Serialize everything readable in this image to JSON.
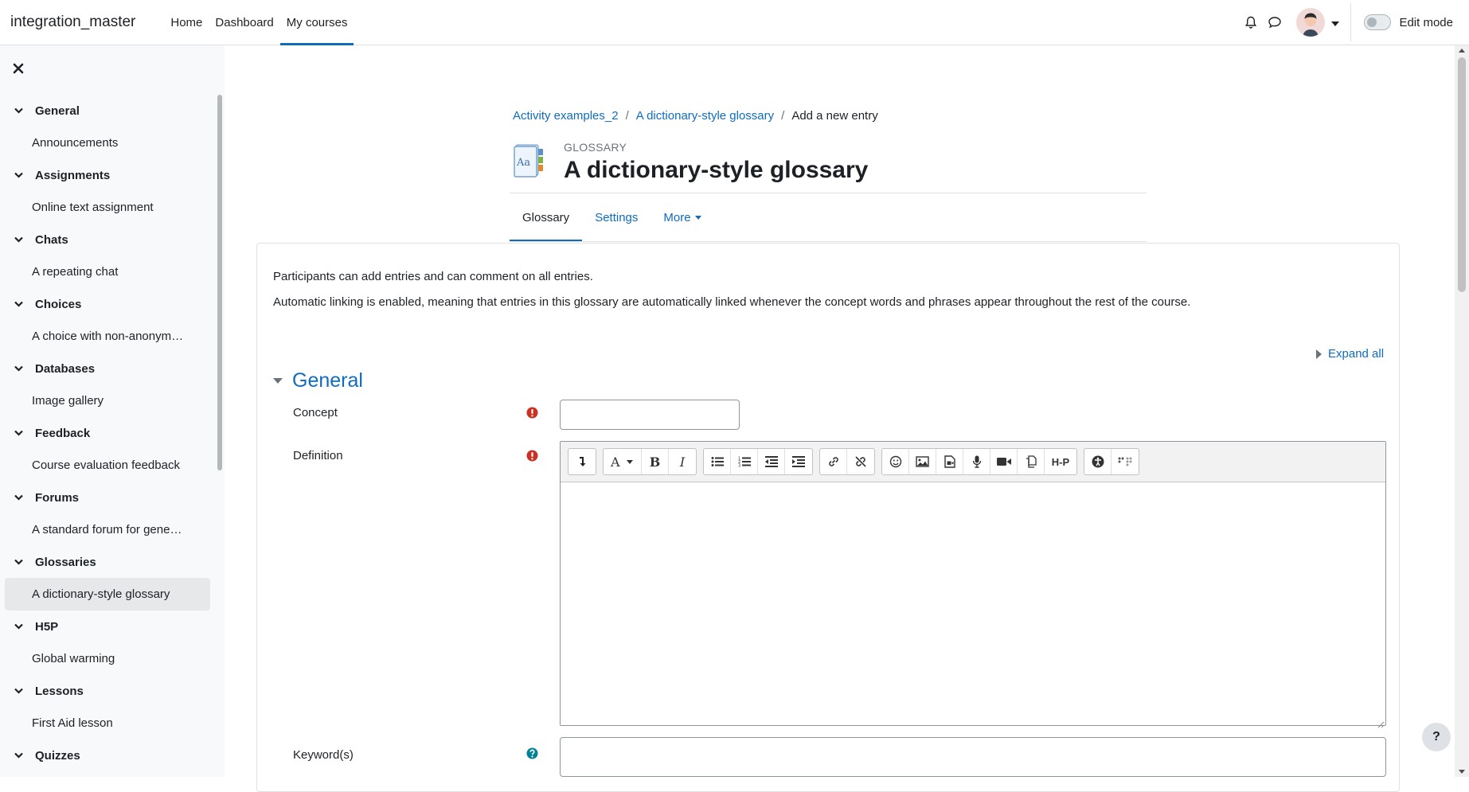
{
  "navbar": {
    "brand": "integration_master",
    "items": [
      {
        "label": "Home"
      },
      {
        "label": "Dashboard"
      },
      {
        "label": "My courses"
      }
    ],
    "edit_mode_label": "Edit mode"
  },
  "course_index": {
    "sections": [
      {
        "title": "General",
        "activities": [
          "Announcements"
        ]
      },
      {
        "title": "Assignments",
        "activities": [
          "Online text assignment"
        ]
      },
      {
        "title": "Chats",
        "activities": [
          "A repeating chat"
        ]
      },
      {
        "title": "Choices",
        "activities": [
          "A choice with non-anonym…"
        ]
      },
      {
        "title": "Databases",
        "activities": [
          "Image gallery"
        ]
      },
      {
        "title": "Feedback",
        "activities": [
          "Course evaluation feedback"
        ]
      },
      {
        "title": "Forums",
        "activities": [
          "A standard forum for gene…"
        ]
      },
      {
        "title": "Glossaries",
        "activities": [
          "A dictionary-style glossary"
        ]
      },
      {
        "title": "H5P",
        "activities": [
          "Global warming"
        ]
      },
      {
        "title": "Lessons",
        "activities": [
          "First Aid lesson"
        ]
      },
      {
        "title": "Quizzes",
        "activities": []
      }
    ],
    "current_activity": "A dictionary-style glossary"
  },
  "breadcrumb": {
    "items": [
      "Activity examples_2",
      "A dictionary-style glossary",
      "Add a new entry"
    ]
  },
  "header": {
    "module_type": "GLOSSARY",
    "title": "A dictionary-style glossary"
  },
  "secondary_nav": {
    "tabs": [
      {
        "label": "Glossary"
      },
      {
        "label": "Settings"
      },
      {
        "label": "More"
      }
    ]
  },
  "intro": {
    "line1": "Participants can add entries and can comment on all entries.",
    "line2": "Automatic linking is enabled, meaning that entries in this glossary are automatically linked whenever the concept words and phrases appear throughout the rest of the course."
  },
  "form": {
    "expand_all": "Expand all",
    "section_title": "General",
    "concept_label": "Concept",
    "concept_value": "",
    "definition_label": "Definition",
    "keywords_label": "Keyword(s)",
    "keywords_value": ""
  },
  "editor_toolbar": {
    "groups": [
      [
        "collapse-icon"
      ],
      [
        "font-style-icon",
        "bold-icon",
        "italic-icon"
      ],
      [
        "unordered-list-icon",
        "ordered-list-icon",
        "outdent-icon",
        "indent-icon"
      ],
      [
        "link-icon",
        "unlink-icon"
      ],
      [
        "emoji-icon",
        "image-icon",
        "media-icon",
        "record-audio-icon",
        "record-video-icon",
        "manage-files-icon",
        "h5p-icon"
      ],
      [
        "accessibility-checker-icon",
        "screenreader-helper-icon"
      ]
    ]
  },
  "help_button": "?",
  "colors": {
    "brand": "#0f6cbf",
    "required": "#ca3120",
    "help": "#008196"
  }
}
